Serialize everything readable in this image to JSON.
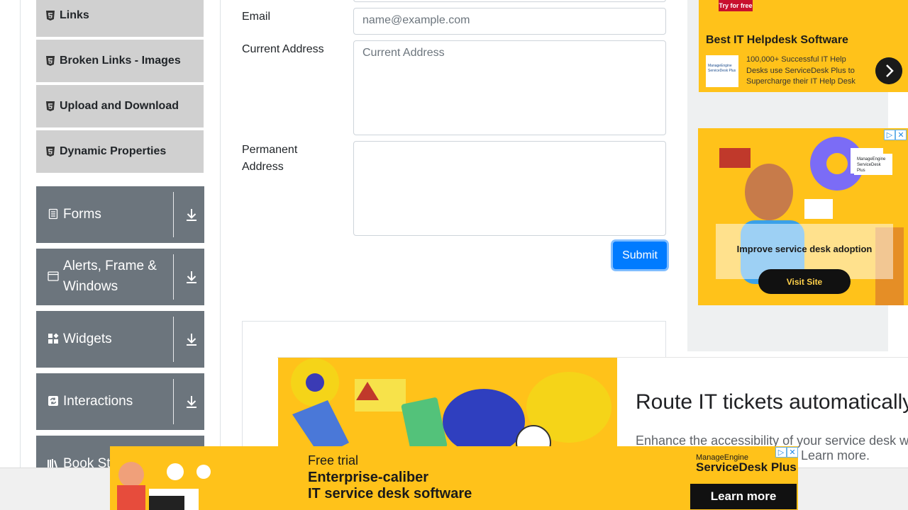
{
  "sidebar": {
    "sub_items": [
      {
        "label": "Links",
        "icon": "html5-icon"
      },
      {
        "label": "Broken Links - Images",
        "icon": "html5-icon"
      },
      {
        "label": "Upload and Download",
        "icon": "html5-icon"
      },
      {
        "label": "Dynamic Properties",
        "icon": "html5-icon"
      }
    ],
    "groups": [
      {
        "label": "Forms",
        "icon": "file-text-icon"
      },
      {
        "label": "Alerts, Frame & Windows",
        "icon": "window-icon"
      },
      {
        "label": "Widgets",
        "icon": "widgets-icon"
      },
      {
        "label": "Interactions",
        "icon": "refresh-icon"
      },
      {
        "label": "Book St",
        "icon": "book-icon"
      }
    ]
  },
  "form": {
    "email_label": "Email",
    "email_placeholder": "name@example.com",
    "current_address_label": "Current Address",
    "current_address_placeholder": "Current Address",
    "permanent_address_label": "Permanent Address",
    "permanent_address_placeholder": "",
    "submit_label": "Submit"
  },
  "ads": {
    "top_right": {
      "badge": "Try for free",
      "title": "Best IT Helpdesk Software",
      "logo_text": "ManageEngine ServiceDesk Plus",
      "description": "100,000+ Successful IT Help Desks use ServiceDesk Plus to Supercharge their IT Help Desk"
    },
    "mid_right": {
      "logo_text": "ManageEngine ServiceDesk Plus",
      "headline": "Improve service desk adoption",
      "cta": "Visit Site"
    },
    "content": {
      "headline": "Route IT tickets automatically",
      "body": "Enhance the accessibility of your service desk w",
      "body_more": "Learn more."
    },
    "bottom": {
      "line1": "Free trial",
      "line2": "Enterprise-caliber",
      "line3": "IT service desk software",
      "brand_top": "ManageEngine",
      "brand_name": "ServiceDesk Plus",
      "cta": "Learn more"
    }
  },
  "colors": {
    "accent": "#007bff",
    "sidebar_group": "#6c757d",
    "sidebar_item": "#d0d0d0",
    "ad_yellow": "#ffc21a"
  }
}
